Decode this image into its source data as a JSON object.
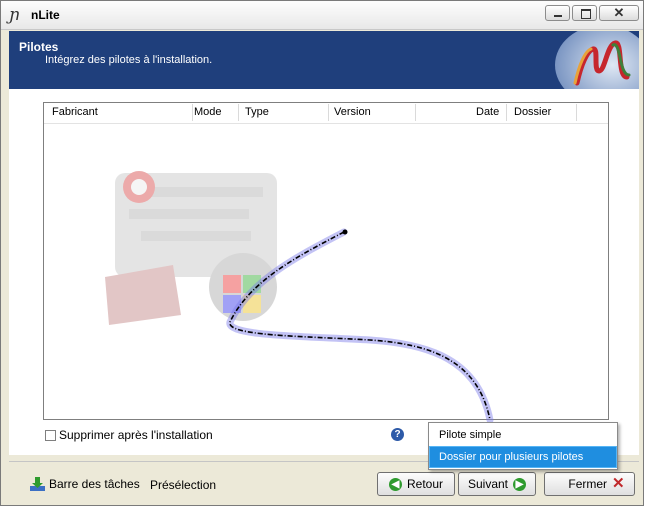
{
  "window": {
    "title": "nLite"
  },
  "header": {
    "title": "Pilotes",
    "subtitle": "Intégrez des pilotes à l'installation."
  },
  "listview": {
    "columns": [
      "Fabricant",
      "Mode",
      "Type",
      "Version",
      "Date",
      "Dossier"
    ]
  },
  "options": {
    "delete_after_install_label": "Supprimer après l'installation",
    "delete_after_install_checked": false
  },
  "footer": {
    "taskbar_label": "Barre des tâches",
    "preset_label": "Présélection",
    "back_label": "Retour",
    "next_label": "Suivant",
    "close_label": "Fermer"
  },
  "insert_menu": {
    "items": [
      {
        "label": "Pilote simple",
        "selected": false
      },
      {
        "label": "Dossier pour plusieurs pilotes",
        "selected": true
      }
    ]
  },
  "colors": {
    "header_bg": "#1f3f7c",
    "menu_selected": "#1f8ee0",
    "accent_green": "#2e9b2e",
    "close_red": "#c0282b"
  }
}
